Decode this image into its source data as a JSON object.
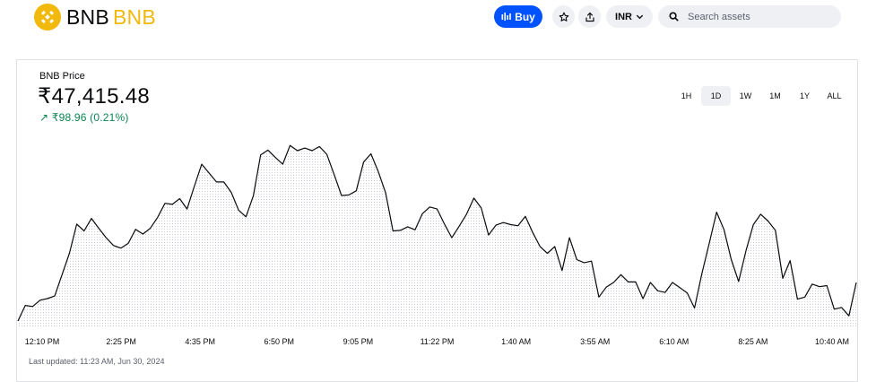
{
  "header": {
    "brand_name": "BNB",
    "brand_ticker": "BNB",
    "buy_label": "Buy",
    "currency": "INR",
    "search_placeholder": "Search assets",
    "brand_color": "#f0b90b",
    "accent_color": "#0052ff"
  },
  "price": {
    "label": "BNB Price",
    "value": "₹47,415.48",
    "change": "↗ ₹98.96 (0.21%)",
    "change_color": "#098551"
  },
  "ranges": [
    {
      "label": "1H",
      "active": false
    },
    {
      "label": "1D",
      "active": true
    },
    {
      "label": "1W",
      "active": false
    },
    {
      "label": "1M",
      "active": false
    },
    {
      "label": "1Y",
      "active": false
    },
    {
      "label": "ALL",
      "active": false
    }
  ],
  "last_updated": "Last updated: 11:23 AM, Jun 30, 2024",
  "chart_data": {
    "type": "area",
    "x_ticks": [
      "12:10 PM",
      "2:25 PM",
      "4:35 PM",
      "6:50 PM",
      "9:05 PM",
      "11:22 PM",
      "1:40 AM",
      "3:55 AM",
      "6:10 AM",
      "8:25 AM",
      "10:40 AM"
    ],
    "series": [
      {
        "values": [
          47182,
          47212,
          47210,
          47222,
          47225,
          47230,
          47271,
          47312,
          47368,
          47355,
          47379,
          47360,
          47342,
          47327,
          47322,
          47331,
          47358,
          47349,
          47360,
          47381,
          47408,
          47406,
          47417,
          47397,
          47441,
          47483,
          47466,
          47449,
          47449,
          47429,
          47395,
          47382,
          47422,
          47501,
          47510,
          47496,
          47483,
          47519,
          47509,
          47514,
          47509,
          47517,
          47502,
          47463,
          47423,
          47424,
          47432,
          47487,
          47503,
          47469,
          47428,
          47355,
          47356,
          47363,
          47357,
          47388,
          47401,
          47397,
          47368,
          47342,
          47364,
          47387,
          47418,
          47399,
          47347,
          47366,
          47371,
          47367,
          47365,
          47383,
          47352,
          47325,
          47312,
          47325,
          47279,
          47342,
          47300,
          47294,
          47297,
          47228,
          47247,
          47256,
          47271,
          47257,
          47257,
          47225,
          47256,
          47240,
          47237,
          47256,
          47246,
          47236,
          47207,
          47273,
          47331,
          47391,
          47358,
          47300,
          47258,
          47317,
          47367,
          47387,
          47374,
          47356,
          47264,
          47298,
          47224,
          47228,
          47253,
          47248,
          47250,
          47205,
          47208,
          47192,
          47256
        ],
        "color": "#0a0b0d"
      }
    ],
    "ylim": [
      47170,
      47540
    ],
    "grid": true
  }
}
